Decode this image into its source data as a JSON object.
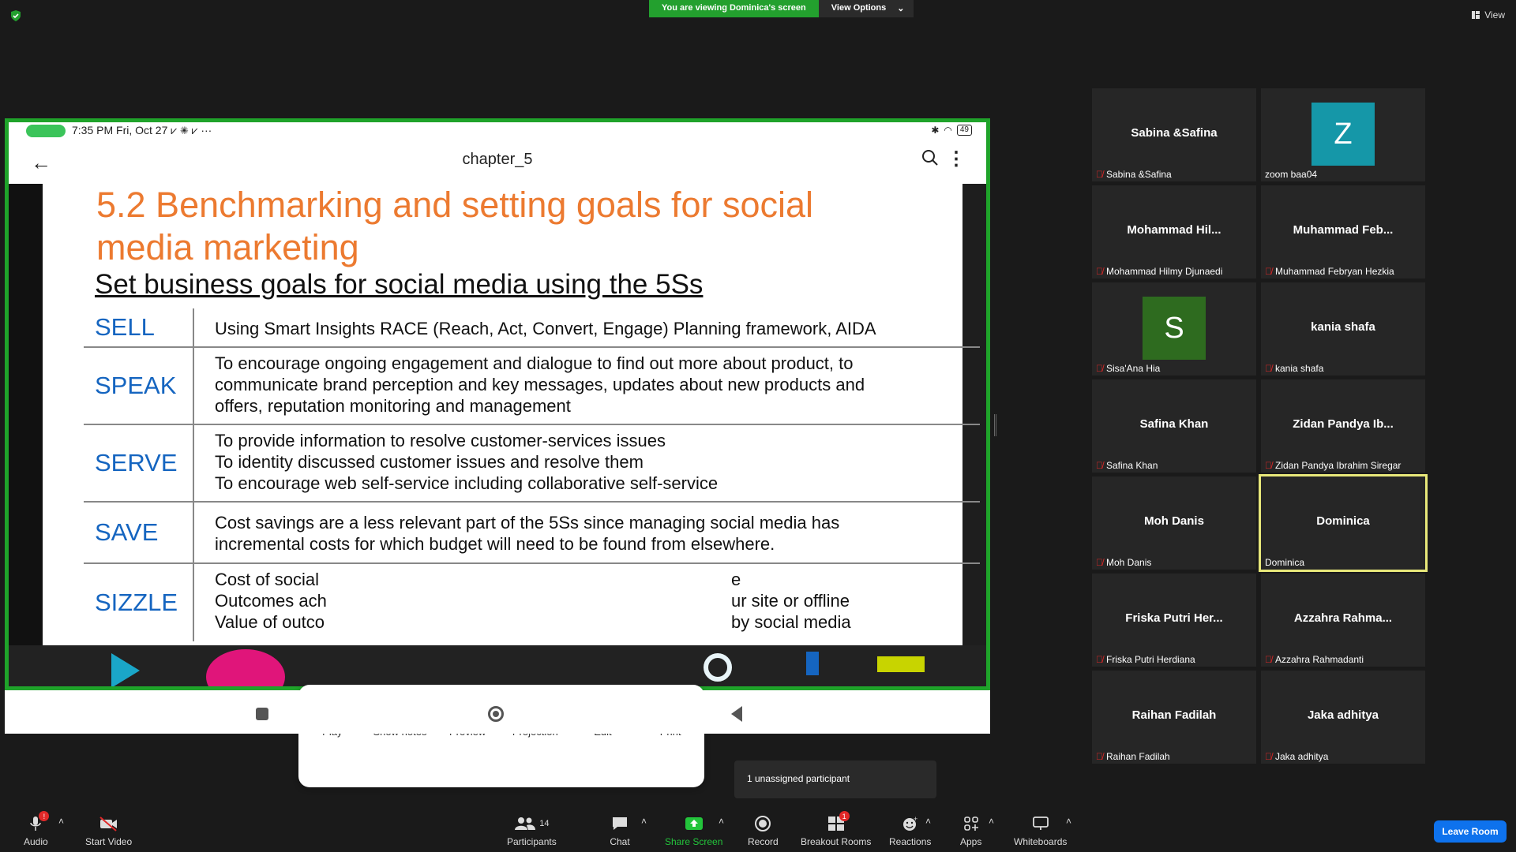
{
  "top": {
    "viewing_text": "You are viewing Dominica's screen",
    "view_options": "View Options",
    "view_label": "View"
  },
  "share": {
    "status_time": "7:35 PM Fri, Oct 27",
    "battery": "49",
    "doc_title": "chapter_5",
    "slide": {
      "title": "5.2 Benchmarking and setting goals for social media marketing",
      "subtitle": "Set business goals for social media using the 5Ss",
      "rows": [
        {
          "key": "SELL",
          "lines": [
            "Using Smart Insights RACE (Reach, Act, Convert, Engage) Planning framework, AIDA"
          ]
        },
        {
          "key": "SPEAK",
          "lines": [
            "To encourage ongoing engagement and dialogue to find out more about product, to",
            "communicate  brand perception and key messages, updates about new products and",
            "offers, reputation monitoring and management"
          ]
        },
        {
          "key": "SERVE",
          "lines": [
            "To provide information to resolve customer-services issues",
            "To identity discussed customer issues and resolve them",
            "To encourage web self-service including collaborative self-service"
          ]
        },
        {
          "key": "SAVE",
          "lines": [
            "Cost savings are a less relevant part of the 5Ss since managing social media has",
            "incremental costs for which budget will need to be found from elsewhere."
          ]
        },
        {
          "key": "SIZZLE",
          "lines": [
            "Cost of social",
            "Outcomes ach",
            "Value of outco"
          ],
          "right_lines": [
            "e",
            "ur site or offline",
            "by social media"
          ]
        }
      ]
    },
    "popup": [
      {
        "label": "Play"
      },
      {
        "label": "Show notes"
      },
      {
        "label": "Preview"
      },
      {
        "label": "Projection"
      },
      {
        "label": "Edit"
      },
      {
        "label": "Print"
      }
    ]
  },
  "participants": [
    {
      "display": "Sabina &Safina",
      "label": "Sabina &Safina",
      "muted": true
    },
    {
      "display": "Z",
      "label": "zoom baa04",
      "muted": false,
      "avatar_color": "#1597a8"
    },
    {
      "display": "Mohammad  Hil...",
      "label": "Mohammad Hilmy Djunaedi",
      "muted": true
    },
    {
      "display": "Muhammad  Feb...",
      "label": "Muhammad Febryan Hezkia",
      "muted": true
    },
    {
      "display": "S",
      "label": "Sisa'Ana Hia",
      "muted": true,
      "avatar_color": "#2e6b1f"
    },
    {
      "display": "kania shafa",
      "label": "kania shafa",
      "muted": true
    },
    {
      "display": "Safina Khan",
      "label": "Safina Khan",
      "muted": true
    },
    {
      "display": "Zidan  Pandya  Ib...",
      "label": "Zidan Pandya Ibrahim Siregar",
      "muted": true
    },
    {
      "display": "Moh Danis",
      "label": "Moh Danis",
      "muted": true
    },
    {
      "display": "Dominica",
      "label": "Dominica",
      "muted": false,
      "active": true
    },
    {
      "display": "Friska  Putri  Her...",
      "label": "Friska Putri Herdiana",
      "muted": true
    },
    {
      "display": "Azzahra  Rahma...",
      "label": "Azzahra Rahmadanti",
      "muted": true
    },
    {
      "display": "Raihan Fadilah",
      "label": "Raihan Fadilah",
      "muted": true
    },
    {
      "display": "Jaka adhitya",
      "label": "Jaka adhitya",
      "muted": true
    }
  ],
  "tooltip": "1 unassigned participant",
  "toolbar": {
    "audio": "Audio",
    "start_video": "Start Video",
    "participants": "Participants",
    "participants_count": "14",
    "chat": "Chat",
    "share_screen": "Share Screen",
    "record": "Record",
    "breakout_rooms": "Breakout Rooms",
    "breakout_badge": "1",
    "reactions": "Reactions",
    "apps": "Apps",
    "whiteboards": "Whiteboards",
    "leave_room": "Leave Room",
    "audio_badge": "!"
  },
  "colors": {
    "share_border": "#1fa32a",
    "title_orange": "#ec7a30",
    "key_blue": "#1565c0",
    "leave_blue": "#0e72ed",
    "active_border": "#e8e87a"
  }
}
